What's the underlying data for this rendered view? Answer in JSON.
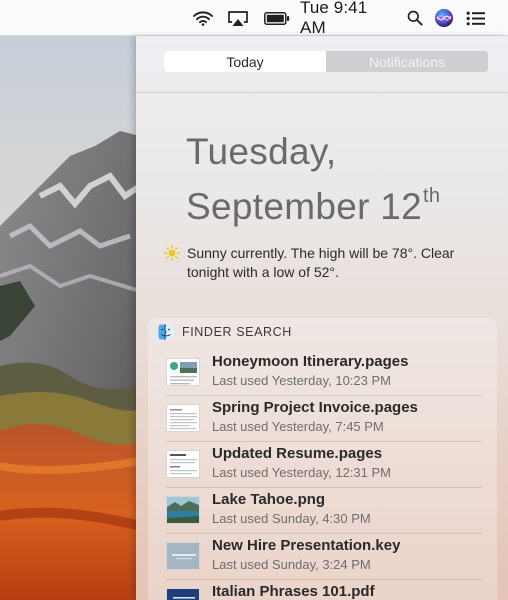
{
  "menubar": {
    "clock": "Tue 9:41 AM",
    "icons": [
      "wifi-icon",
      "airplay-icon",
      "battery-icon",
      "spotlight-icon",
      "siri-icon",
      "notification-center-icon"
    ]
  },
  "panel": {
    "tabs": [
      {
        "label": "Today",
        "active": true
      },
      {
        "label": "Notifications",
        "active": false
      }
    ],
    "date": {
      "weekday": "Tuesday,",
      "month_day": "September 12",
      "suffix": "th"
    },
    "weather": {
      "icon": "sun-icon",
      "text": "Sunny currently. The high will be 78°.  Clear tonight with a low of 52°."
    },
    "finder": {
      "title": "FINDER SEARCH",
      "icon": "finder-icon",
      "results": [
        {
          "name": "Honeymoon Itinerary.pages",
          "meta": "Last used Yesterday, 10:23 PM",
          "thumb": "pages-thumbnail"
        },
        {
          "name": "Spring Project Invoice.pages",
          "meta": "Last used Yesterday, 7:45 PM",
          "thumb": "pages-thumbnail"
        },
        {
          "name": "Updated Resume.pages",
          "meta": "Last used Yesterday, 12:31 PM",
          "thumb": "pages-thumbnail"
        },
        {
          "name": "Lake Tahoe.png",
          "meta": "Last used Sunday, 4:30 PM",
          "thumb": "image-thumbnail"
        },
        {
          "name": "New Hire Presentation.key",
          "meta": "Last used Sunday, 3:24 PM",
          "thumb": "keynote-thumbnail"
        },
        {
          "name": "Italian Phrases 101.pdf",
          "meta": "",
          "thumb": "pdf-thumbnail"
        }
      ]
    }
  },
  "colors": {
    "siri_gradient": [
      "#3a3bd6",
      "#d24bd8",
      "#34c7f3"
    ],
    "sun": "#f5c518"
  }
}
